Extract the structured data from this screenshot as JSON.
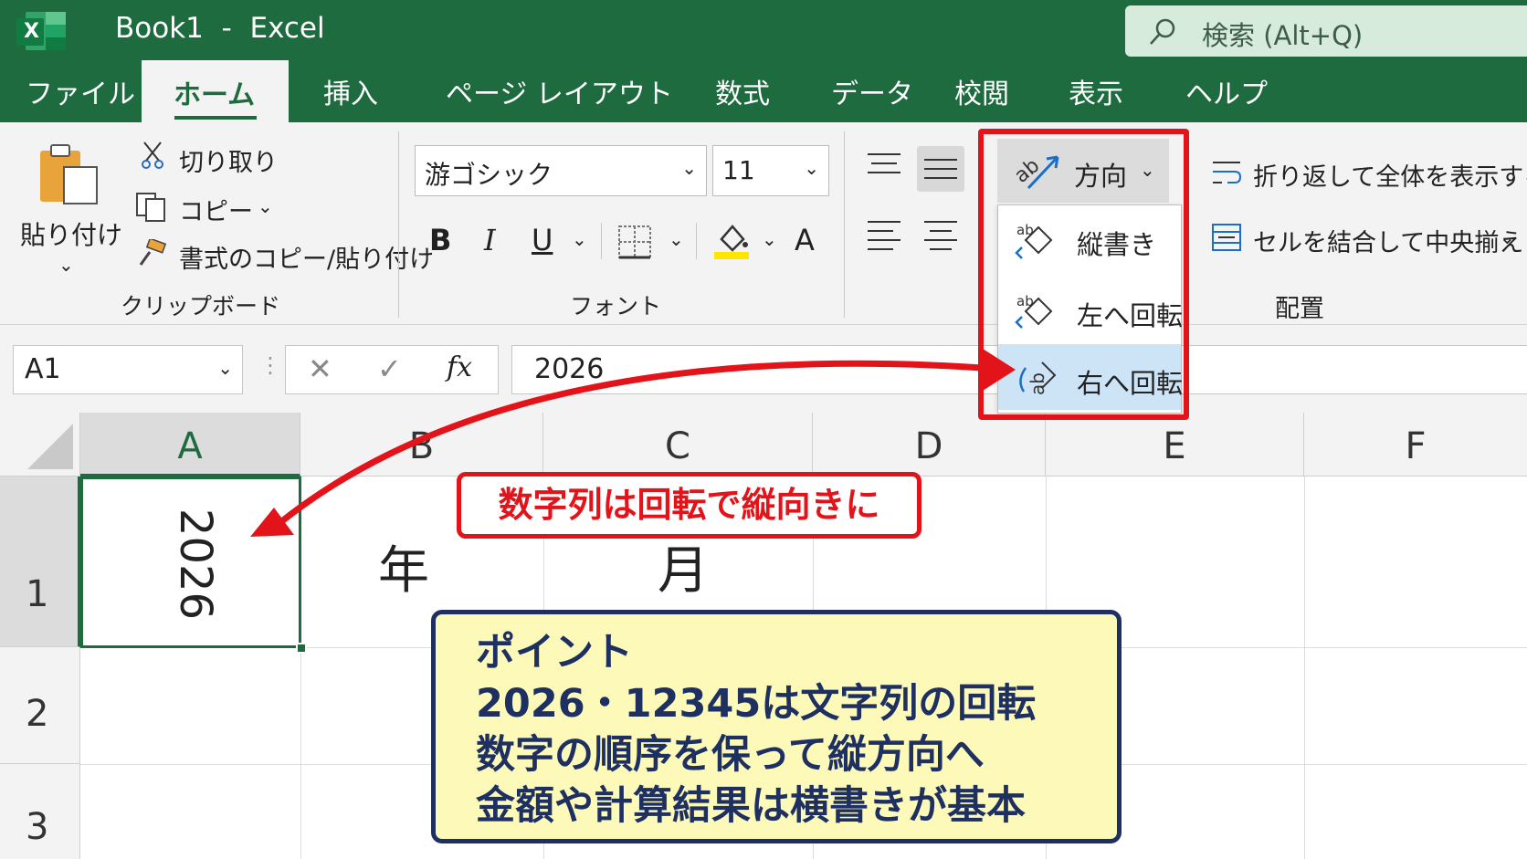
{
  "app": {
    "icon_letter": "X",
    "title": "Book1  -  Excel",
    "search_placeholder": "検索 (Alt+Q)"
  },
  "tabs": [
    "ファイル",
    "ホーム",
    "挿入",
    "ページ レイアウト",
    "数式",
    "データ",
    "校閲",
    "表示",
    "ヘルプ"
  ],
  "active_tab": "ホーム",
  "ribbon": {
    "clipboard": {
      "paste": "貼り付け",
      "cut": "切り取り",
      "copy": "コピー",
      "format_painter": "書式のコピー/貼り付け",
      "group_label": "クリップボード"
    },
    "font": {
      "font_name": "游ゴシック",
      "font_size": "11",
      "bold": "B",
      "italic": "I",
      "underline": "U",
      "font_color": "A",
      "group_label": "フォント"
    },
    "alignment": {
      "orientation": "方向",
      "wrap_text": "折り返して全体を表示する",
      "merge_center": "セルを結合して中央揃え",
      "group_label": "配置"
    }
  },
  "orientation_menu": {
    "items": [
      "縦書き",
      "左へ回転",
      "右へ回転"
    ],
    "highlighted": "右へ回転"
  },
  "formula_bar": {
    "name_box": "A1",
    "cancel": "✕",
    "enter": "✓",
    "fx": "fx",
    "value": "2026"
  },
  "sheet": {
    "columns": [
      "A",
      "B",
      "C",
      "D",
      "E",
      "F"
    ],
    "rows": [
      "1",
      "2",
      "3"
    ],
    "cells": {
      "A1": "2026",
      "B1": "年",
      "C1": "月"
    },
    "selected_cell": "A1"
  },
  "annotations": {
    "callout": "数字列は回転で縦向きに",
    "point_lines": [
      "ポイント",
      "2026・12345は文字列の回転",
      "数字の順序を保って縦方向へ",
      "金額や計算結果は横書きが基本"
    ]
  },
  "colors": {
    "excel_green": "#1e6b40",
    "highlight_red": "#e3131a",
    "note_navy": "#1d3061",
    "note_yellow": "#fdf9b9",
    "menu_highlight": "#cde4f7"
  }
}
